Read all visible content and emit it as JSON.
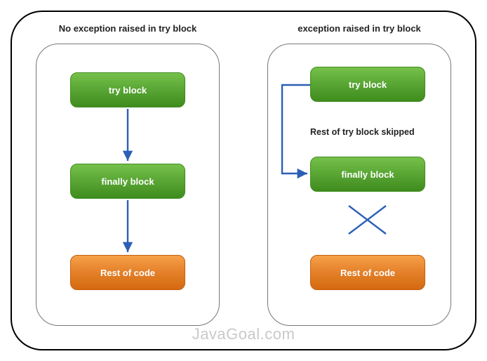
{
  "diagram": {
    "left": {
      "title": "No exception raised in try block",
      "blocks": {
        "try": "try block",
        "finally": "finally block",
        "rest": "Rest of code"
      }
    },
    "right": {
      "title": "exception raised in try block",
      "blocks": {
        "try": "try block",
        "finally": "finally block",
        "rest": "Rest of code"
      },
      "skip_label": "Rest of try block skipped"
    },
    "watermark": "JavaGoal.com"
  }
}
